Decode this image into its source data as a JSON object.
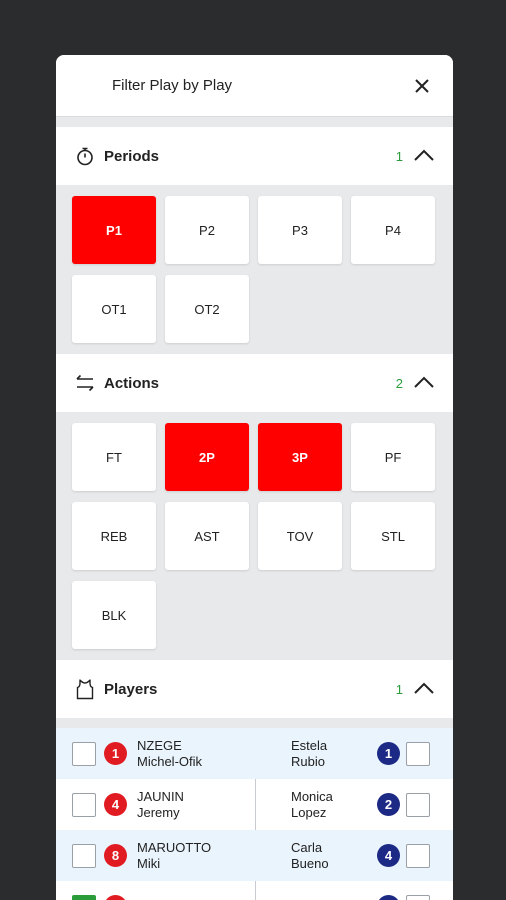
{
  "header": {
    "title": "Filter Play by Play"
  },
  "periods": {
    "title": "Periods",
    "count": "1",
    "items": [
      "P1",
      "P2",
      "P3",
      "P4",
      "OT1",
      "OT2"
    ]
  },
  "actions": {
    "title": "Actions",
    "count": "2",
    "items": [
      "FT",
      "2P",
      "3P",
      "PF",
      "REB",
      "AST",
      "TOV",
      "STL",
      "BLK"
    ]
  },
  "players": {
    "title": "Players",
    "count": "1",
    "rows": [
      {
        "left": {
          "number": "1",
          "last": "NZEGE",
          "first": "Michel-Ofik"
        },
        "right": {
          "number": "1",
          "line1": "Estela",
          "line2": "Rubio"
        }
      },
      {
        "left": {
          "number": "4",
          "last": "JAUNIN",
          "first": "Jeremy"
        },
        "right": {
          "number": "2",
          "line1": "Monica",
          "line2": "Lopez"
        }
      },
      {
        "left": {
          "number": "8",
          "last": "MARUOTTO",
          "first": "Miki"
        },
        "right": {
          "number": "4",
          "line1": "Carla",
          "line2": "Bueno"
        }
      }
    ]
  },
  "colors": {
    "selected": "#ff0000",
    "count": "#2a9d3a",
    "home": "#e11b22",
    "away": "#1c2a86"
  }
}
